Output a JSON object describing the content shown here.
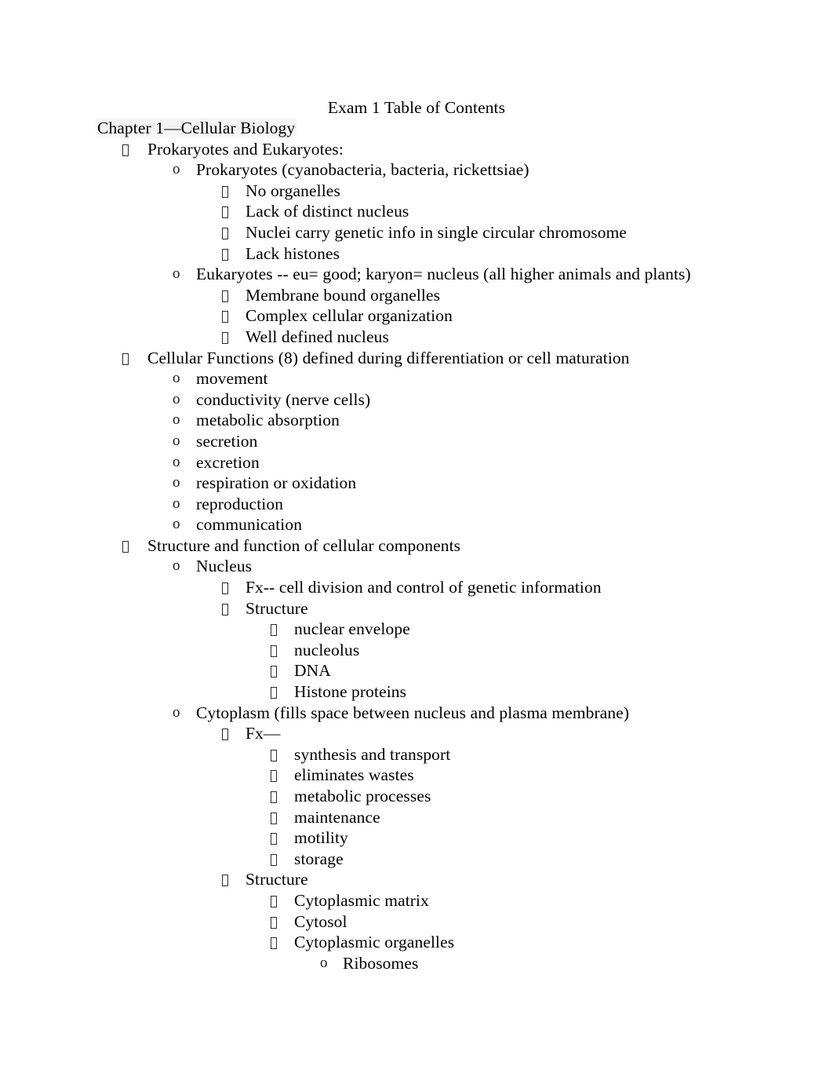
{
  "document": {
    "title": "Exam 1 Table of Contents",
    "heading": "Chapter 1—Cellular Biology",
    "bullet_glyphs": {
      "square": "missing-glyph-box",
      "circle": "o"
    },
    "outline": [
      {
        "level": 1,
        "marker": "square",
        "text": "Prokaryotes and Eukaryotes:"
      },
      {
        "level": 2,
        "marker": "circle",
        "text": "Prokaryotes (cyanobacteria, bacteria, rickettsiae)"
      },
      {
        "level": 3,
        "marker": "square",
        "text": "No organelles"
      },
      {
        "level": 3,
        "marker": "square",
        "text": "Lack of distinct nucleus"
      },
      {
        "level": 3,
        "marker": "square",
        "text": "Nuclei carry genetic info in single circular chromosome"
      },
      {
        "level": 3,
        "marker": "square",
        "text": "Lack histones"
      },
      {
        "level": 2,
        "marker": "circle",
        "text": "Eukaryotes -- eu= good; karyon= nucleus (all higher animals and plants)"
      },
      {
        "level": 3,
        "marker": "square",
        "text": "Membrane bound organelles"
      },
      {
        "level": 3,
        "marker": "square",
        "text": "Complex cellular organization"
      },
      {
        "level": 3,
        "marker": "square",
        "text": "Well defined nucleus"
      },
      {
        "level": 1,
        "marker": "square",
        "text": "Cellular Functions (8) defined during differentiation or cell maturation"
      },
      {
        "level": 2,
        "marker": "circle",
        "text": "movement"
      },
      {
        "level": 2,
        "marker": "circle",
        "text": "conductivity (nerve cells)"
      },
      {
        "level": 2,
        "marker": "circle",
        "text": "metabolic absorption"
      },
      {
        "level": 2,
        "marker": "circle",
        "text": "secretion"
      },
      {
        "level": 2,
        "marker": "circle",
        "text": "excretion"
      },
      {
        "level": 2,
        "marker": "circle",
        "text": "respiration or oxidation"
      },
      {
        "level": 2,
        "marker": "circle",
        "text": "reproduction"
      },
      {
        "level": 2,
        "marker": "circle",
        "text": "communication"
      },
      {
        "level": 1,
        "marker": "square",
        "text": "Structure and function of cellular components"
      },
      {
        "level": 2,
        "marker": "circle",
        "text": "Nucleus"
      },
      {
        "level": 3,
        "marker": "square",
        "text": "Fx-- cell division and control of genetic information"
      },
      {
        "level": 3,
        "marker": "square",
        "text": "Structure"
      },
      {
        "level": 4,
        "marker": "square",
        "text": "nuclear envelope"
      },
      {
        "level": 4,
        "marker": "square",
        "text": "nucleolus"
      },
      {
        "level": 4,
        "marker": "square",
        "text": "DNA"
      },
      {
        "level": 4,
        "marker": "square",
        "text": "Histone proteins"
      },
      {
        "level": 2,
        "marker": "circle",
        "text": "Cytoplasm (fills space between nucleus and plasma membrane)"
      },
      {
        "level": 3,
        "marker": "square",
        "text": "Fx—"
      },
      {
        "level": 4,
        "marker": "square",
        "text": "synthesis and transport"
      },
      {
        "level": 4,
        "marker": "square",
        "text": "eliminates wastes"
      },
      {
        "level": 4,
        "marker": "square",
        "text": "metabolic processes"
      },
      {
        "level": 4,
        "marker": "square",
        "text": "maintenance"
      },
      {
        "level": 4,
        "marker": "square",
        "text": "motility"
      },
      {
        "level": 4,
        "marker": "square",
        "text": "storage"
      },
      {
        "level": 3,
        "marker": "square",
        "text": "Structure"
      },
      {
        "level": 4,
        "marker": "square",
        "text": "Cytoplasmic matrix"
      },
      {
        "level": 4,
        "marker": "square",
        "text": "Cytosol"
      },
      {
        "level": 4,
        "marker": "square",
        "text": "Cytoplasmic organelles"
      },
      {
        "level": 5,
        "marker": "circle",
        "text": "Ribosomes"
      }
    ]
  },
  "colors": {
    "page_background": "#ffffff",
    "text": "#000000",
    "heading_highlight": "#ebebeb"
  }
}
